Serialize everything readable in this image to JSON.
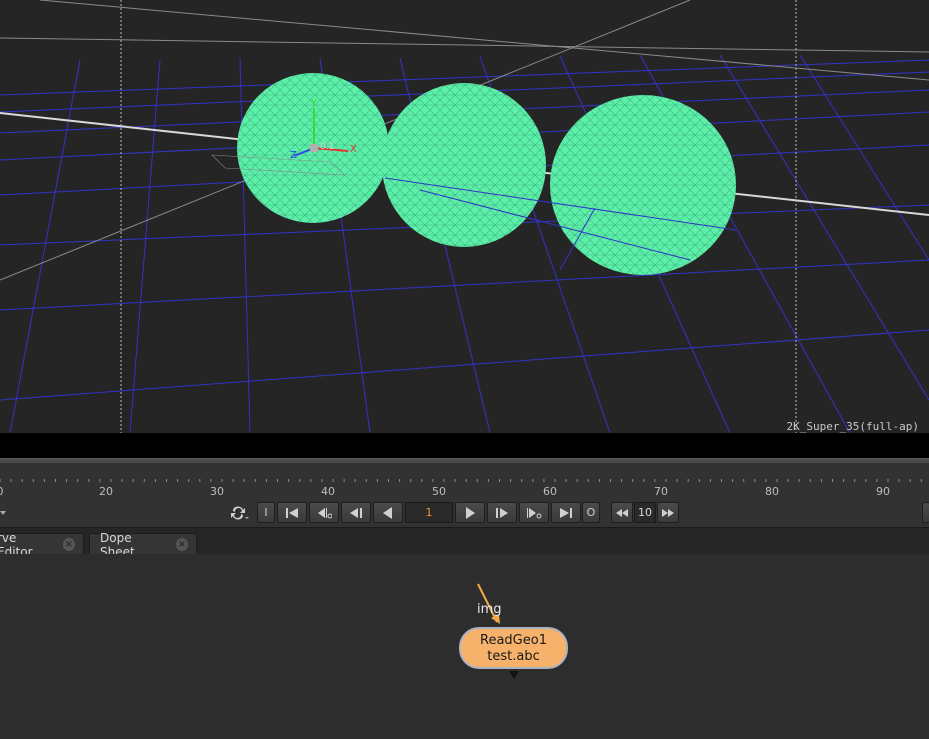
{
  "viewer": {
    "format_label": "2K_Super_35(full-ap)",
    "axis_labels": {
      "x": "X",
      "y": "Y",
      "z": "Z"
    },
    "axis_value": "0.1",
    "colors": {
      "background": "#252525",
      "grid": "#3a3ad0",
      "sphere": "#5cf0a8",
      "sphere_wire": "#3ab882"
    }
  },
  "timeline": {
    "ticks": [
      "0",
      "20",
      "30",
      "40",
      "50",
      "60",
      "70",
      "80",
      "90"
    ],
    "current_frame": "1",
    "increment": "10",
    "in_label": "I",
    "out_label": "O"
  },
  "tabs": [
    {
      "label": "rve Editor",
      "close": "×"
    },
    {
      "label": "Dope Sheet",
      "close": "×"
    }
  ],
  "nodegraph": {
    "node": {
      "name": "ReadGeo1",
      "file": "test.abc",
      "color": "#f6b26b"
    },
    "input_label": "img"
  },
  "icons": [
    "loop-icon",
    "first-frame-icon",
    "prev-key-icon",
    "step-back-icon",
    "play-back-icon",
    "play-forward-icon",
    "step-forward-icon",
    "next-key-icon",
    "last-frame-icon",
    "rewind-icon",
    "forward-icon"
  ]
}
